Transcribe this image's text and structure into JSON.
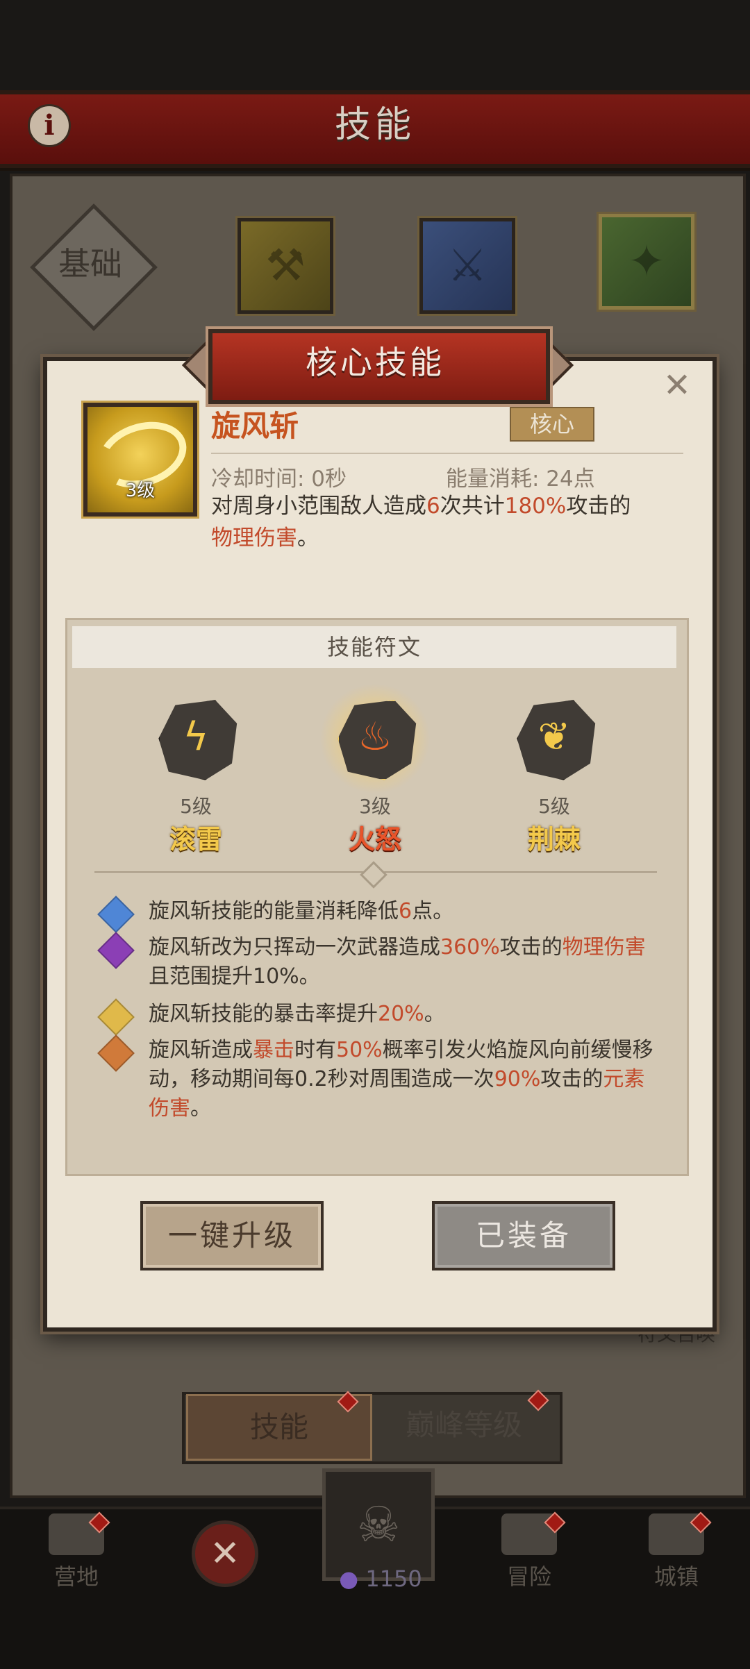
{
  "header": {
    "title": "技能",
    "info_icon": "info-icon"
  },
  "tabs": {
    "basic_label": "基础",
    "category_icons": [
      "axe-icon",
      "hammer-icon",
      "claw-icon"
    ]
  },
  "modal": {
    "banner_title": "核心技能",
    "skill": {
      "name": "旋风斩",
      "level": "3级",
      "tag": "核心",
      "cooldown": "冷却时间: 0秒",
      "energy": "能量消耗: 24点",
      "desc_1": "对周身小范围敌人造成",
      "desc_2": "6",
      "desc_3": "次共计",
      "desc_4": "180%",
      "desc_5": "攻击的",
      "desc_6": "物理伤害",
      "desc_7": "。"
    },
    "rune_section_title": "技能符文",
    "runes": [
      {
        "level": "5级",
        "name": "滚雷",
        "icon": "lightning-icon"
      },
      {
        "level": "3级",
        "name": "火怒",
        "icon": "flame-icon"
      },
      {
        "level": "5级",
        "name": "荆棘",
        "icon": "thorn-icon"
      }
    ],
    "effects": [
      {
        "color": "#4f86d6",
        "parts": [
          "旋风斩技能的能量消耗降低",
          "6",
          "点。"
        ]
      },
      {
        "color": "#8b3fb5",
        "parts": [
          "旋风斩改为只挥动一次武器造成",
          "360%",
          "攻击的",
          "物理伤害",
          "且范围提升10%。"
        ]
      },
      {
        "color": "#e0b94a",
        "parts": [
          "旋风斩技能的暴击率提升",
          "20%",
          "。"
        ]
      },
      {
        "color": "#d07a3a",
        "parts": [
          "旋风斩造成",
          "暴击",
          "时有",
          "50%",
          "概率引发火焰旋风向前缓慢移动，移动期间每0.2秒对周围造成一次",
          "90%",
          "攻击的",
          "元素伤害",
          "。"
        ]
      }
    ],
    "buttons": {
      "upgrade": "一键升级",
      "equip": "已装备"
    }
  },
  "background": {
    "rune_summon": "符文召唤",
    "bottom_tabs": {
      "skill": "技能",
      "peak": "巅峰等级"
    }
  },
  "nav": {
    "camp": "营地",
    "adventure": "冒险",
    "town": "城镇",
    "currency_count": "1150"
  },
  "colors": {
    "accent_red": "#c24a2b",
    "skill_name": "#c6531f",
    "rune_yellow": "#f3c94b",
    "rune_red": "#e9542a"
  }
}
